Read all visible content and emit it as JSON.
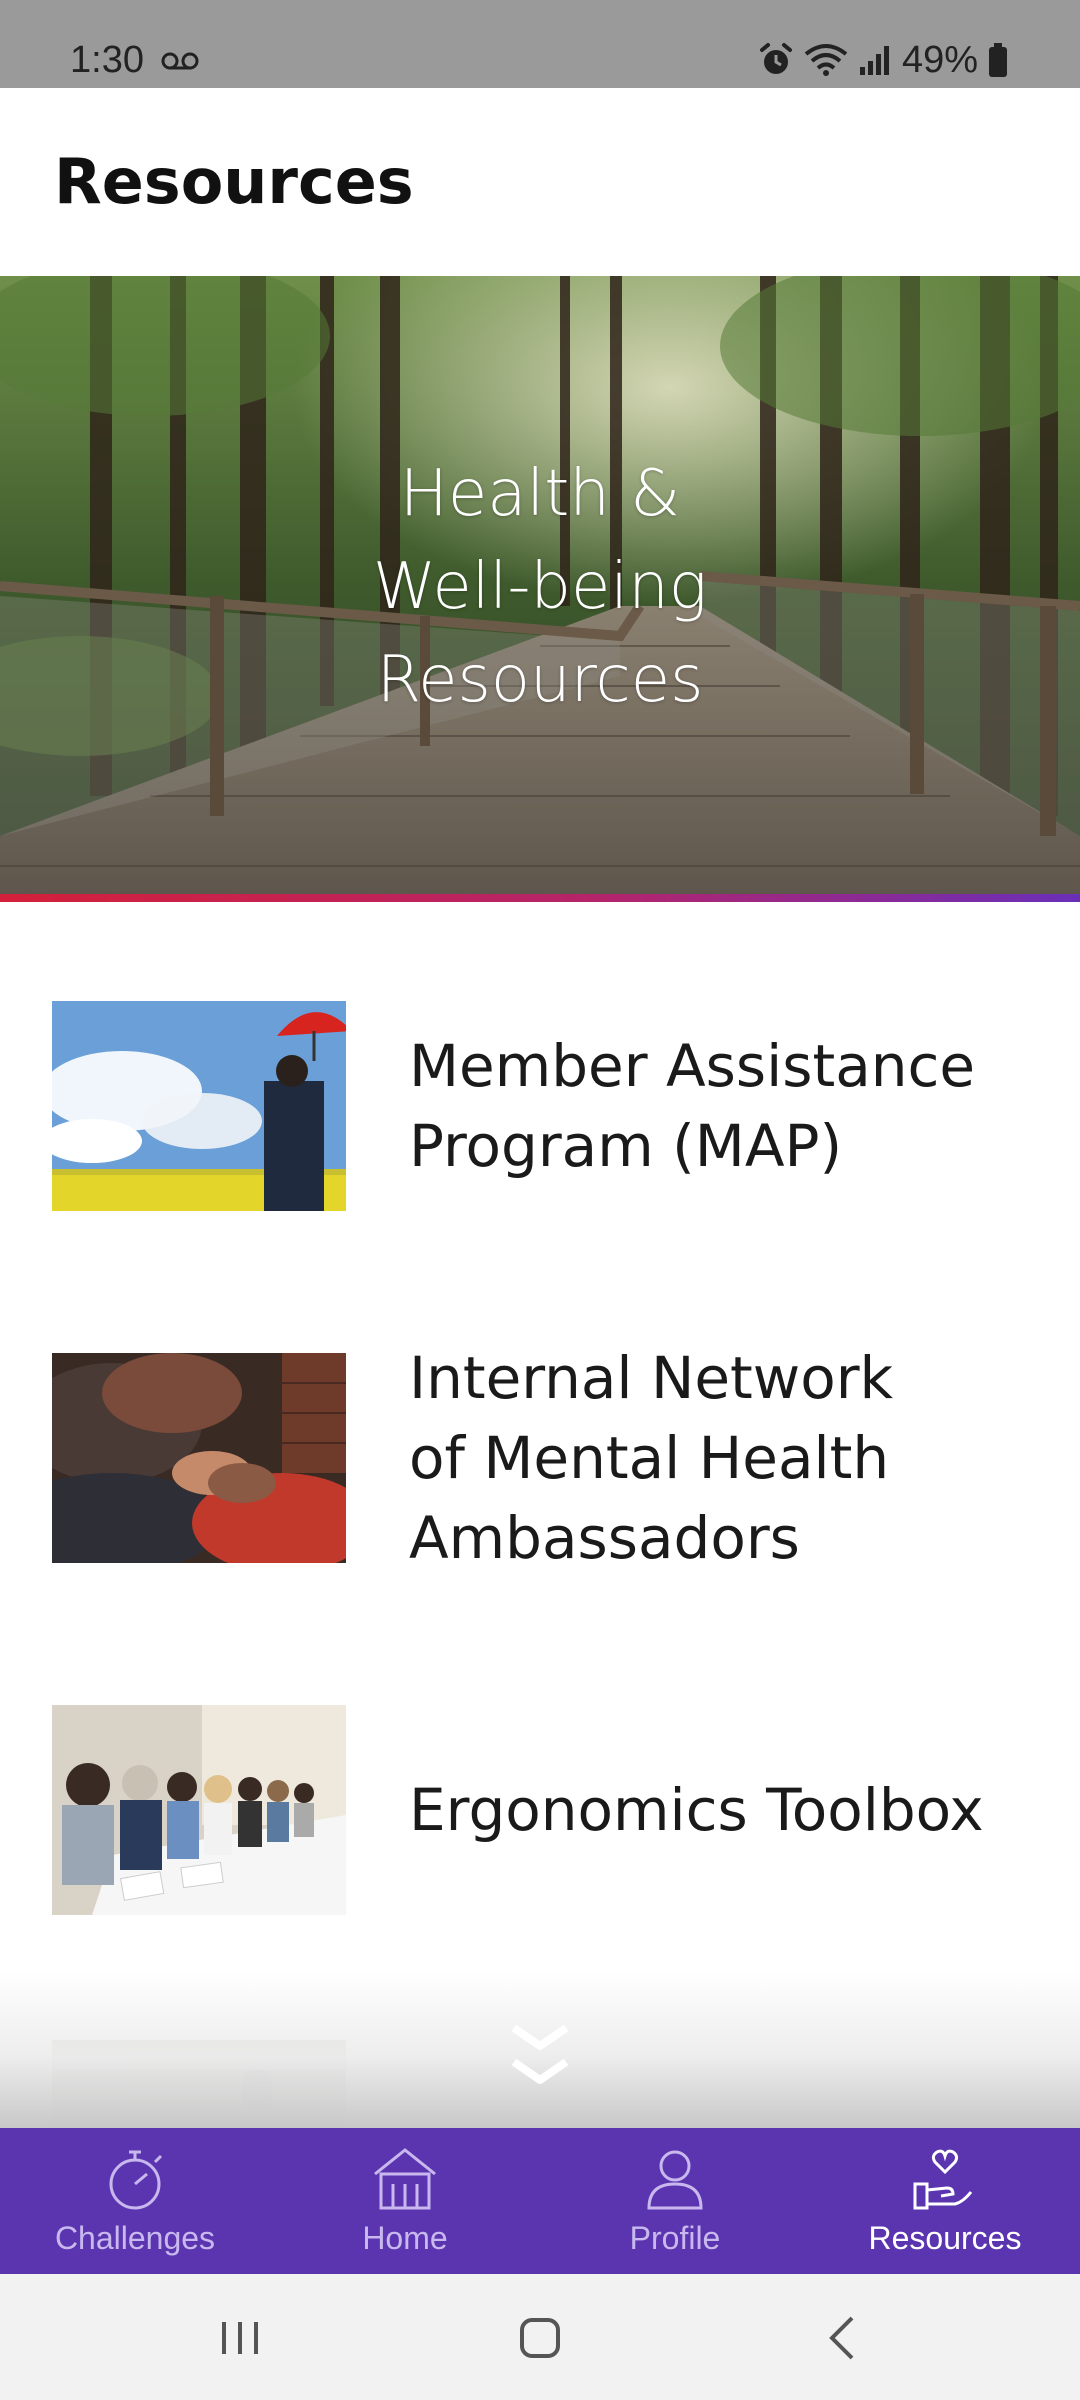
{
  "status_bar": {
    "time": "1:30",
    "battery": "49%"
  },
  "header": {
    "title": "Resources"
  },
  "hero": {
    "title": "Health &\nWell-being\nResources",
    "image": "forest-boardwalk-photo"
  },
  "resources": [
    {
      "label": "Member Assistance\nProgram (MAP)",
      "image": "man-with-red-umbrella-in-field-photo"
    },
    {
      "label": "Internal Network\nof Mental Health\nAmbassadors",
      "image": "people-holding-hands-photo"
    },
    {
      "label": "Ergonomics Toolbox",
      "image": "smiling-team-at-table-photo"
    },
    {
      "label": "",
      "image": "partially-visible-photo"
    }
  ],
  "bottom_nav": {
    "active": "Resources",
    "tabs": [
      {
        "label": "Challenges",
        "icon": "stopwatch-icon"
      },
      {
        "label": "Home",
        "icon": "home-icon"
      },
      {
        "label": "Profile",
        "icon": "person-icon"
      },
      {
        "label": "Resources",
        "icon": "hand-heart-icon"
      }
    ]
  },
  "colors": {
    "nav_background": "#5b35b0",
    "hero_rule_start": "#d4203a",
    "hero_rule_end": "#6a2fb8",
    "status_bar": "#9a9a9a"
  }
}
